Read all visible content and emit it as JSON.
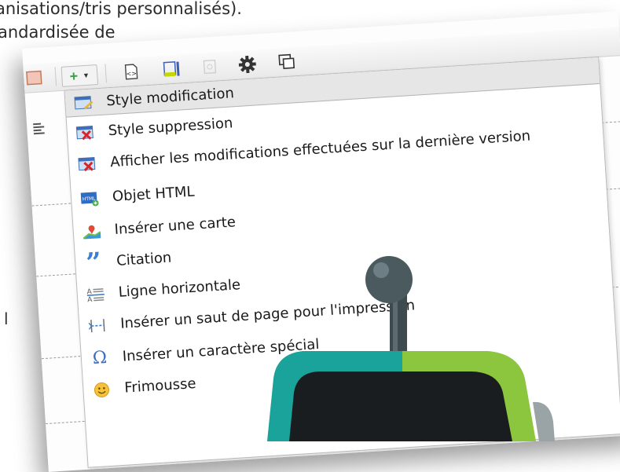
{
  "background_text": {
    "line1": "anisations/tris personnalisés).",
    "line2": "andardisée de",
    "stray_letter": "l"
  },
  "toolbar": {
    "icons": [
      "block-icon",
      "plus-icon",
      "chevron-down-icon",
      "html-source-icon",
      "template-icon",
      "disabled-icon",
      "gear-icon",
      "preview-icon"
    ]
  },
  "menu": {
    "items": [
      {
        "label": "Style modification",
        "icon": "style-modify-icon"
      },
      {
        "label": "Style suppression",
        "icon": "style-delete-icon"
      },
      {
        "label": "Afficher les modifications effectuées sur la dernière version",
        "icon": "show-changes-icon"
      },
      {
        "label": "Objet HTML",
        "icon": "html-object-icon"
      },
      {
        "label": "Insérer une carte",
        "icon": "map-icon"
      },
      {
        "label": "Citation",
        "icon": "quote-icon"
      },
      {
        "label": "Ligne horizontale",
        "icon": "horizontal-line-icon"
      },
      {
        "label": "Insérer un saut de page pour l'impression",
        "icon": "page-break-icon"
      },
      {
        "label": "Insérer un caractère spécial",
        "icon": "omega-icon"
      },
      {
        "label": "Frimousse",
        "icon": "smiley-icon"
      }
    ]
  },
  "colors": {
    "robot_teal": "#1aa39a",
    "robot_green": "#8cc63f",
    "robot_dark": "#1a1d1f",
    "robot_antenna": "#4a5a5e"
  }
}
